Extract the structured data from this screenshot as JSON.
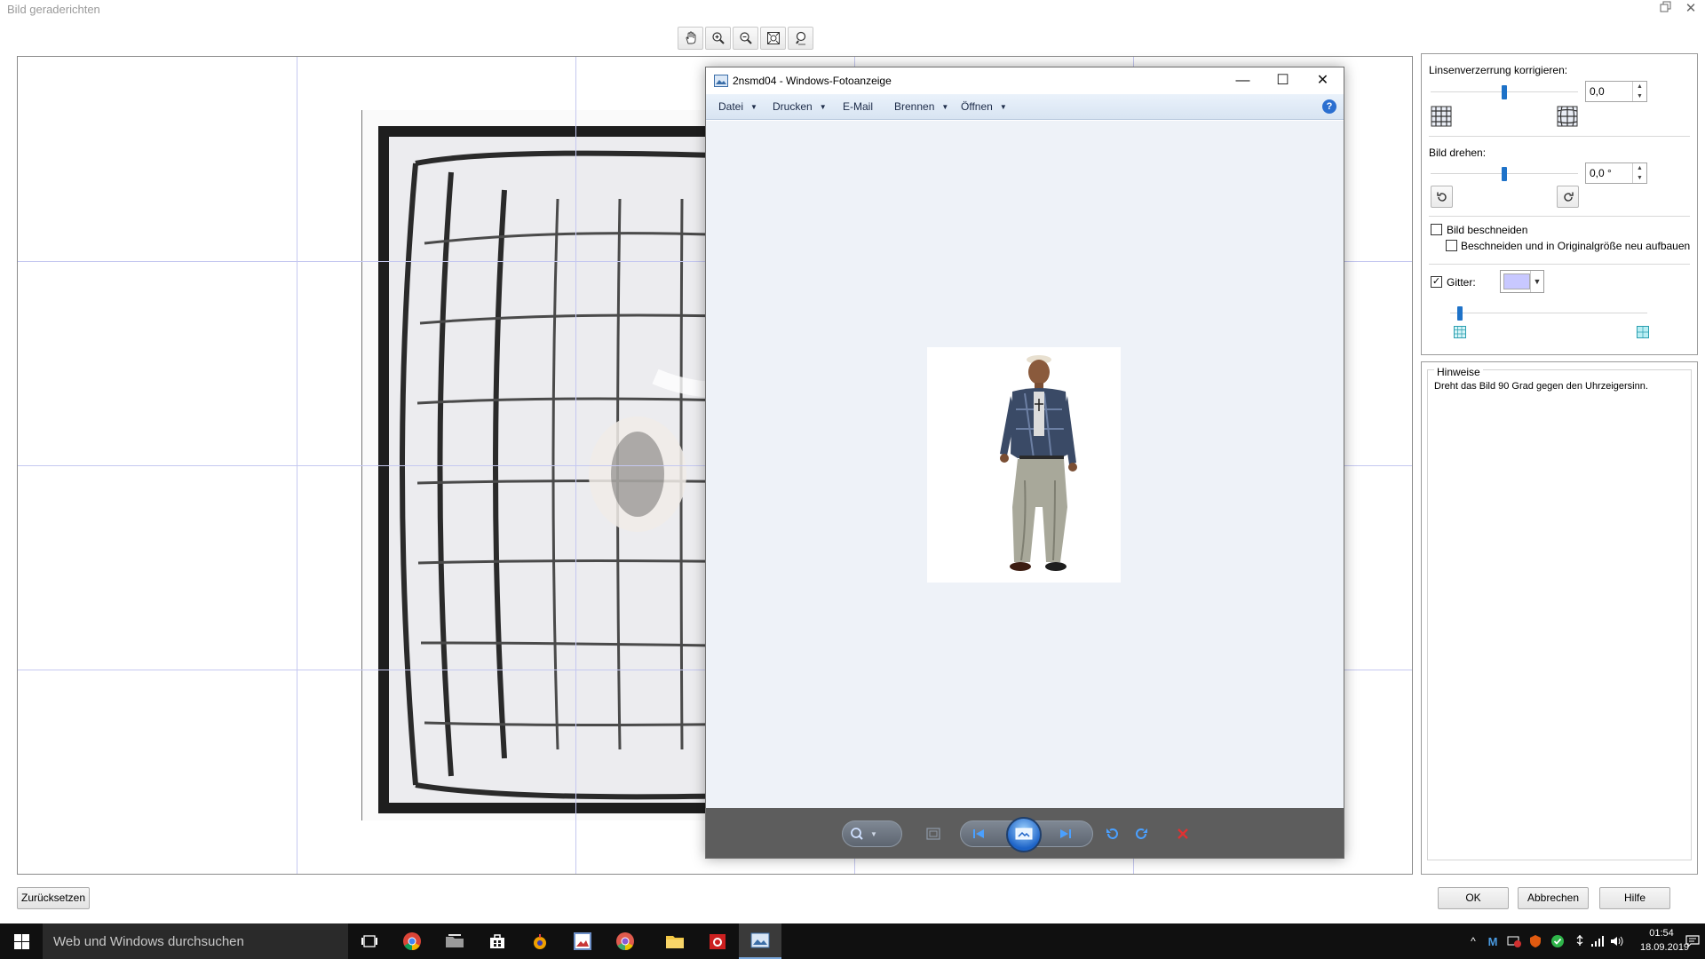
{
  "dialog": {
    "title": "Bild geraderichten",
    "toolbar": {
      "tools": [
        {
          "name": "pan-tool",
          "icon": "hand-icon"
        },
        {
          "name": "zoom-in-tool",
          "icon": "zoom-in-icon"
        },
        {
          "name": "zoom-out-tool",
          "icon": "zoom-out-icon"
        },
        {
          "name": "fit-to-window-tool",
          "icon": "fit-window-icon"
        },
        {
          "name": "actual-size-tool",
          "icon": "zoom-100-icon"
        }
      ]
    },
    "panel": {
      "lens_label": "Linsenverzerrung korrigieren:",
      "lens_value": "0,0",
      "lens_slider_fraction": 0.5,
      "rotate_label": "Bild drehen:",
      "rotate_value": "0,0 °",
      "rotate_slider_fraction": 0.5,
      "crop_label": "Bild beschneiden",
      "crop_checked": false,
      "crop_rebuild_label": "Beschneiden und in Originalgröße neu aufbauen",
      "crop_rebuild_checked": false,
      "grid_label": "Gitter:",
      "grid_checked": true,
      "grid_color": "#c8c8ff",
      "grid_size_fraction": 0.05
    },
    "hints": {
      "caption": "Hinweise",
      "text": "Dreht das Bild 90 Grad gegen den Uhrzeigersinn."
    },
    "buttons": {
      "reset": "Zurücksetzen",
      "ok": "OK",
      "cancel": "Abbrechen",
      "help": "Hilfe"
    }
  },
  "viewer": {
    "title": "2nsmd04 - Windows-Fotoanzeige",
    "menu": [
      {
        "label": "Datei",
        "has_dropdown": true
      },
      {
        "label": "Drucken",
        "has_dropdown": true
      },
      {
        "label": "E-Mail",
        "has_dropdown": false
      },
      {
        "label": "Brennen",
        "has_dropdown": true
      },
      {
        "label": "Öffnen",
        "has_dropdown": true
      }
    ],
    "help_glyph": "?",
    "window_buttons": {
      "minimize": "—",
      "maximize": "☐",
      "close": "✕"
    }
  },
  "taskbar": {
    "search_placeholder": "Web und Windows durchsuchen",
    "apps": [
      "task-view-icon",
      "chrome-icon",
      "folder-tools-icon",
      "store-icon",
      "app-icon",
      "pictures-icon",
      "chrome-canary-icon",
      "file-explorer-icon",
      "camera-app-icon",
      "photo-viewer-icon"
    ],
    "active_app": "photo-viewer-icon",
    "tray_icons": [
      "chevron-up-icon",
      "m-app-icon",
      "network-warning-icon",
      "shield-icon",
      "check-icon",
      "usb-icon",
      "signal-icon",
      "volume-icon",
      "notification-icon"
    ],
    "time": "01:54",
    "date": "18.09.2019"
  }
}
